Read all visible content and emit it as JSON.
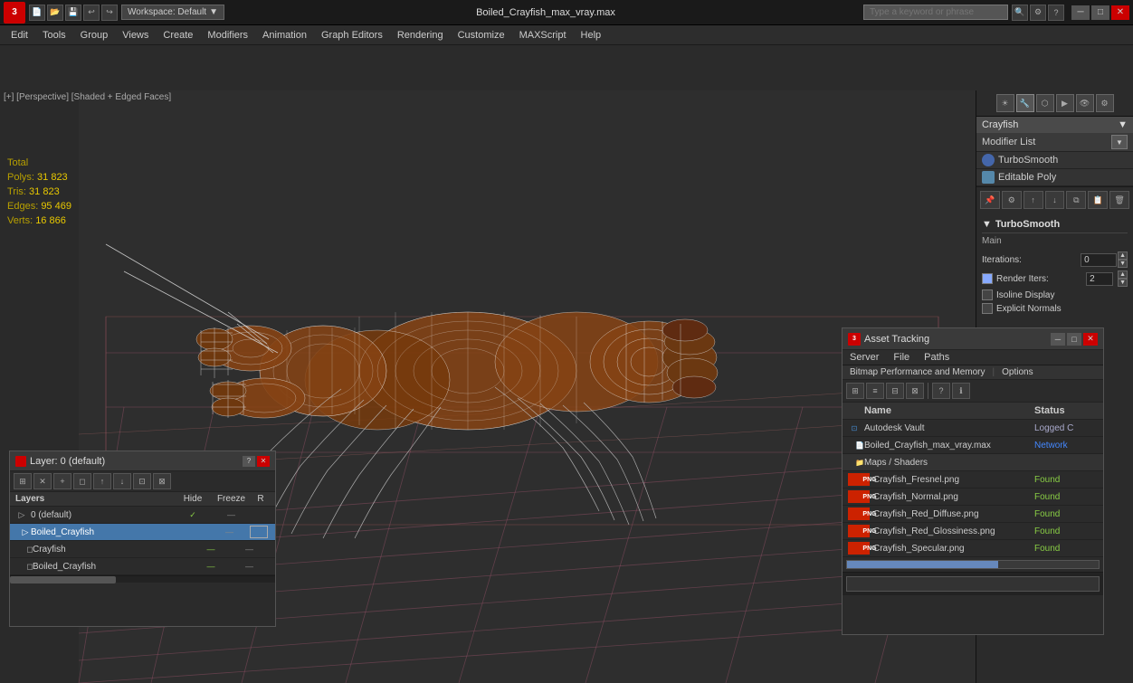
{
  "titlebar": {
    "logo": "3",
    "filename": "Boiled_Crayfish_max_vray.max",
    "workspace": "Workspace: Default",
    "search_placeholder": "Type a keyword or phrase",
    "min": "─",
    "max": "□",
    "close": "✕"
  },
  "menubar": {
    "items": [
      "Edit",
      "Tools",
      "Group",
      "Views",
      "Create",
      "Modifiers",
      "Animation",
      "Graph Editors",
      "Rendering",
      "Customize",
      "MAXScript",
      "Help"
    ]
  },
  "viewport": {
    "label": "[+] [Perspective] [Shaded + Edged Faces]",
    "stats": {
      "total_label": "Total",
      "polys_label": "Polys:",
      "polys_value": "31 823",
      "tris_label": "Tris:",
      "tris_value": "31 823",
      "edges_label": "Edges:",
      "edges_value": "95 469",
      "verts_label": "Verts:",
      "verts_value": "16 866"
    }
  },
  "right_panel": {
    "object_name": "Crayfish",
    "modifier_list_label": "Modifier List",
    "modifiers": [
      {
        "name": "TurboSmooth",
        "type": "round"
      },
      {
        "name": "Editable Poly",
        "type": "square"
      }
    ],
    "turbosmooth": {
      "title": "TurboSmooth",
      "main_label": "Main",
      "iterations_label": "Iterations:",
      "iterations_value": "0",
      "render_iters_label": "Render Iters:",
      "render_iters_value": "2",
      "isoline_label": "Isoline Display",
      "explicit_normals_label": "Explicit Normals"
    }
  },
  "asset_tracking": {
    "title": "Asset Tracking",
    "menubar": [
      "Server",
      "File",
      "Paths"
    ],
    "submenu": "Bitmap Performance and Memory",
    "submenu2": "Options",
    "col_name": "Name",
    "col_status": "Status",
    "rows": [
      {
        "name": "Autodesk Vault",
        "status": "Logged C",
        "type": "vault",
        "indent": 0
      },
      {
        "name": "Boiled_Crayfish_max_vray.max",
        "status": "Network",
        "type": "max",
        "indent": 1
      },
      {
        "name": "Maps / Shaders",
        "status": "",
        "type": "folder",
        "indent": 1
      },
      {
        "name": "Crayfish_Fresnel.png",
        "status": "Found",
        "type": "png",
        "indent": 2
      },
      {
        "name": "Crayfish_Normal.png",
        "status": "Found",
        "type": "png",
        "indent": 2
      },
      {
        "name": "Crayfish_Red_Diffuse.png",
        "status": "Found",
        "type": "png",
        "indent": 2
      },
      {
        "name": "Crayfish_Red_Glossiness.png",
        "status": "Found",
        "type": "png",
        "indent": 2
      },
      {
        "name": "Crayfish_Specular.png",
        "status": "Found",
        "type": "png",
        "indent": 2
      }
    ],
    "min": "─",
    "max": "□",
    "close": "✕"
  },
  "layer_window": {
    "title": "Layer: 0 (default)",
    "question": "?",
    "close": "✕",
    "col_layers": "Layers",
    "col_hide": "Hide",
    "col_freeze": "Freeze",
    "col_r": "R",
    "layers": [
      {
        "name": "0 (default)",
        "hide_check": "✓",
        "freeze": "—",
        "r": "",
        "selected": false,
        "indent": 0
      },
      {
        "name": "Boiled_Crayfish",
        "hide_check": "",
        "freeze": "—",
        "r": "□",
        "selected": true,
        "indent": 1
      },
      {
        "name": "Crayfish",
        "hide_check": "",
        "freeze": "—",
        "r": "",
        "selected": false,
        "indent": 2
      },
      {
        "name": "Boiled_Crayfish",
        "hide_check": "",
        "freeze": "—",
        "r": "",
        "selected": false,
        "indent": 2
      }
    ]
  }
}
